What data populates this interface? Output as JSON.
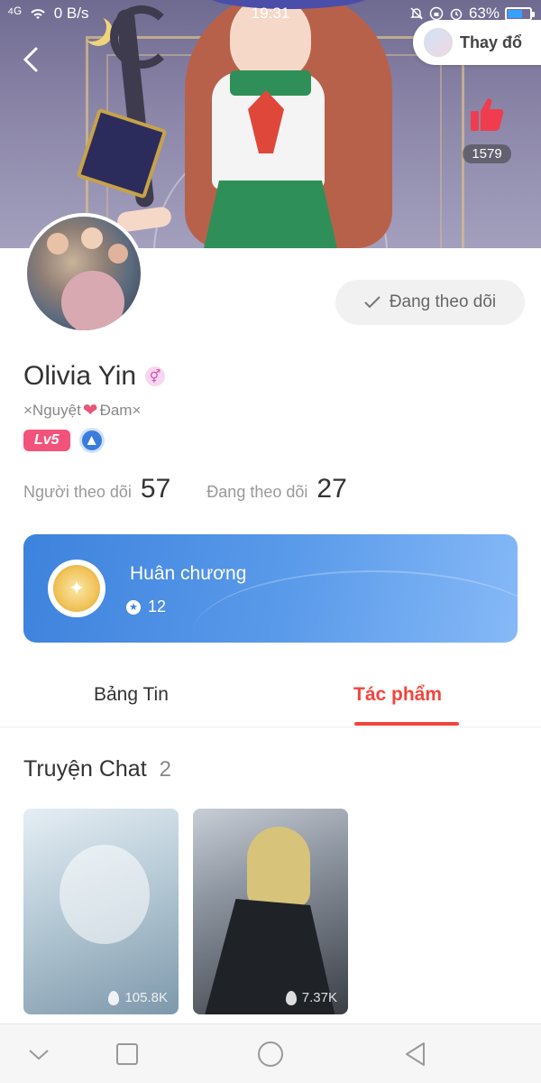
{
  "status_bar": {
    "signal": "⁴ᴳ",
    "net_speed": "0 B/s",
    "time": "19:31",
    "battery": "63%",
    "battery_level": 0.63
  },
  "header": {
    "change_button_label": "Thay đổ",
    "likes_count": "1579"
  },
  "profile": {
    "name": "Olivia Yin",
    "gender_symbol": "⚥",
    "signature_left": "×Nguyệt ",
    "signature_heart": "❤",
    "signature_right": "Đam×",
    "level": "Lv5",
    "follow_button": "Đang theo dõi",
    "followers_label": "Người theo dõi",
    "followers_value": "57",
    "following_label": "Đang theo dõi",
    "following_value": "27"
  },
  "medal_card": {
    "title": "Huân chương",
    "count": "12"
  },
  "tabs": [
    {
      "label": "Bảng Tin",
      "active": false
    },
    {
      "label": "Tác phẩm",
      "active": true
    }
  ],
  "section": {
    "title": "Truyện Chat",
    "count": "2"
  },
  "stories": [
    {
      "views": "105.8K"
    },
    {
      "views": "7.37K"
    }
  ],
  "colors": {
    "accent_red": "#f2453d",
    "medal_blue": "#3d82dd",
    "level_pink": "#f2537a",
    "like_red": "#ef3d4f"
  },
  "icons": [
    "back-icon",
    "thumbs-up-icon",
    "check-icon",
    "gender-icon",
    "medal-icon",
    "flame-icon",
    "nav-down-icon",
    "nav-square-icon",
    "nav-circle-icon",
    "nav-back-triangle-icon"
  ]
}
